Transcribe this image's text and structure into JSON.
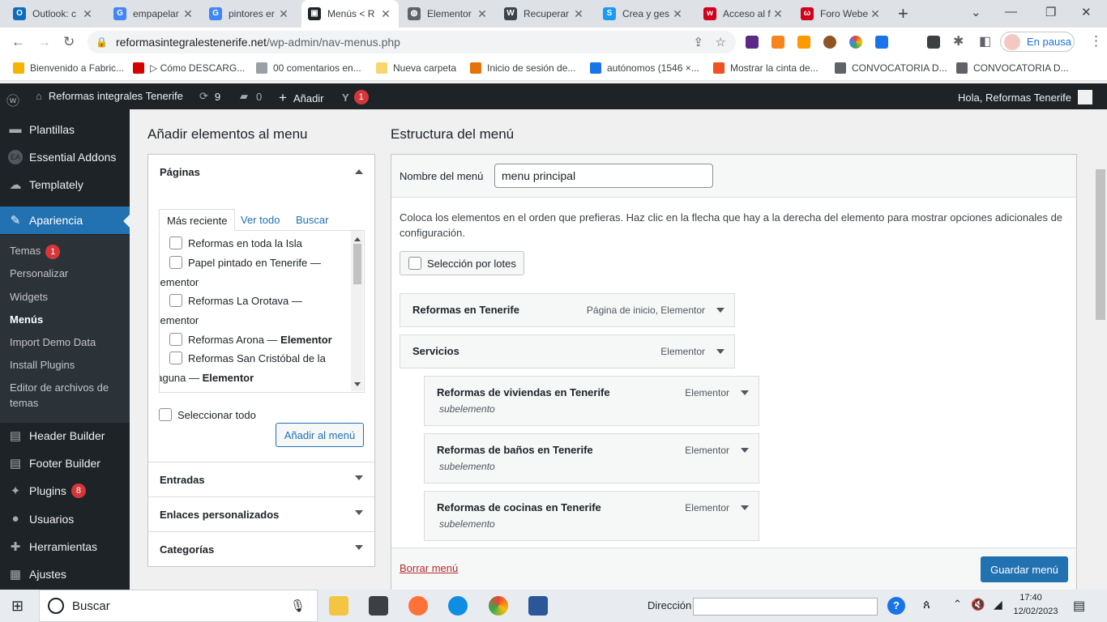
{
  "browser": {
    "tabs": [
      {
        "label": "Outlook: c",
        "icon": "outlook-icon",
        "color": "#0f6cbd",
        "glyph": "O"
      },
      {
        "label": "empapelar",
        "icon": "google-icon",
        "color": "#4285f4",
        "glyph": "G"
      },
      {
        "label": "pintores er",
        "icon": "google-icon",
        "color": "#4285f4",
        "glyph": "G"
      },
      {
        "label": "Menús < R",
        "icon": "tab-site-icon",
        "color": "#1d2327",
        "glyph": "▣"
      },
      {
        "label": "Elementor",
        "icon": "globe-icon",
        "color": "#5f6368",
        "glyph": "◍"
      },
      {
        "label": "Recuperar",
        "icon": "wordpress-icon",
        "color": "#3c434a",
        "glyph": "W"
      },
      {
        "label": "Crea y ges",
        "icon": "site-builder-icon",
        "color": "#1a9af7",
        "glyph": "S"
      },
      {
        "label": "Acceso al f",
        "icon": "webnode-icon",
        "color": "#d0021b",
        "glyph": "w"
      },
      {
        "label": "Foro Webe",
        "icon": "webnode-icon",
        "color": "#d0021b",
        "glyph": "ω"
      }
    ],
    "tab_close": "✕",
    "new_tab": "+",
    "url_host": "reformasintegralestenerife.net",
    "url_path": "/wp-admin/nav-menus.php",
    "profile_status": "En pausa",
    "bookmarks": [
      {
        "label": "Bienvenido a Fabric...",
        "color": "#f4b400"
      },
      {
        "label": "▷ Cómo DESCARG...",
        "color": "#d50000"
      },
      {
        "label": "00 comentarios en...",
        "color": "#9aa0a6"
      },
      {
        "label": "Nueva carpeta",
        "color": "#f9d56e"
      },
      {
        "label": "Inicio de sesión de...",
        "color": "#e8710a"
      },
      {
        "label": "autónomos (1546 ×...",
        "color": "#1a73e8"
      },
      {
        "label": "Mostrar la cinta de...",
        "color": "#f25022"
      },
      {
        "label": "CONVOCATORIA D...",
        "color": "#5f6368"
      },
      {
        "label": "CONVOCATORIA D...",
        "color": "#5f6368"
      }
    ]
  },
  "adminbar": {
    "site_name": "Reformas integrales Tenerife",
    "updates": "9",
    "comments": "0",
    "add_new": "Añadir",
    "yoast_count": "1",
    "greeting": "Hola, Reformas Tenerife"
  },
  "sidebar": {
    "top_items": [
      {
        "label": "Plantillas",
        "icon": "folder-icon",
        "glyph": "▬"
      },
      {
        "label": "Essential Addons",
        "icon": "essential-addons-icon",
        "glyph": "EA"
      },
      {
        "label": "Templately",
        "icon": "templately-icon",
        "glyph": "☁"
      }
    ],
    "active": {
      "label": "Apariencia",
      "icon": "paintbrush-icon",
      "glyph": "✎"
    },
    "submenu": [
      {
        "label": "Temas",
        "badge": "1"
      },
      {
        "label": "Personalizar",
        "badge": ""
      },
      {
        "label": "Widgets",
        "badge": ""
      },
      {
        "label": "Menús",
        "badge": ""
      },
      {
        "label": "Import Demo Data",
        "badge": ""
      },
      {
        "label": "Install Plugins",
        "badge": ""
      },
      {
        "label": "Editor de archivos de",
        "badge": ""
      },
      {
        "label": "temas",
        "badge": ""
      }
    ],
    "bottom_items": [
      {
        "label": "Header Builder",
        "icon": "header-builder-icon",
        "glyph": "▤",
        "badge": ""
      },
      {
        "label": "Footer Builder",
        "icon": "footer-builder-icon",
        "glyph": "▤",
        "badge": ""
      },
      {
        "label": "Plugins",
        "icon": "plugin-icon",
        "glyph": "✦",
        "badge": "8"
      },
      {
        "label": "Usuarios",
        "icon": "users-icon",
        "glyph": "●",
        "badge": ""
      },
      {
        "label": "Herramientas",
        "icon": "wrench-icon",
        "glyph": "✚",
        "badge": ""
      },
      {
        "label": "Ajustes",
        "icon": "settings-icon",
        "glyph": "▦",
        "badge": ""
      }
    ]
  },
  "add_items": {
    "heading": "Añadir elementos al menu",
    "pages_title": "Páginas",
    "tabs": [
      "Más reciente",
      "Ver todo",
      "Buscar"
    ],
    "pages": [
      {
        "line1": "Reformas en toda la Isla",
        "line2": ""
      },
      {
        "line1": "Papel pintado en Tenerife —",
        "line2": "Elementor"
      },
      {
        "line1": "Reformas La Orotava —",
        "line2": "Elementor"
      },
      {
        "line1": "Reformas Arona — ",
        "bold": "Elementor",
        "line2": ""
      },
      {
        "line1": "Reformas San Cristóbal de la",
        "line2": "Laguna — ",
        "bold2": "Elementor"
      }
    ],
    "select_all": "Seleccionar todo",
    "add_button": "Añadir al menú",
    "sections": [
      "Entradas",
      "Enlaces personalizados",
      "Categorías"
    ]
  },
  "structure": {
    "heading": "Estructura del menú",
    "menu_name_label": "Nombre del menú",
    "menu_name_value": "menu principal",
    "instructions": "Coloca los elementos en el orden que prefieras. Haz clic en la flecha que hay a la derecha del elemento para mostrar opciones adicionales de configuración.",
    "bulk_select": "Selección por lotes",
    "items": [
      {
        "title": "Reformas en Tenerife",
        "type": "Página de inicio, Elementor",
        "sub": ""
      },
      {
        "title": "Servicios",
        "type": "Elementor",
        "sub": ""
      },
      {
        "title": "Reformas de viviendas en Tenerife",
        "type": "Elementor",
        "sub": "subelemento"
      },
      {
        "title": "Reformas de baños en Tenerife",
        "type": "Elementor",
        "sub": "subelemento"
      },
      {
        "title": "Reformas de cocinas en Tenerife",
        "type": "Elementor",
        "sub": "subelemento"
      }
    ],
    "delete_menu": "Borrar menú",
    "save_button": "Guardar menú"
  },
  "taskbar": {
    "search_placeholder": "Buscar",
    "address_label": "Dirección",
    "time": "17:40",
    "date": "12/02/2023"
  }
}
